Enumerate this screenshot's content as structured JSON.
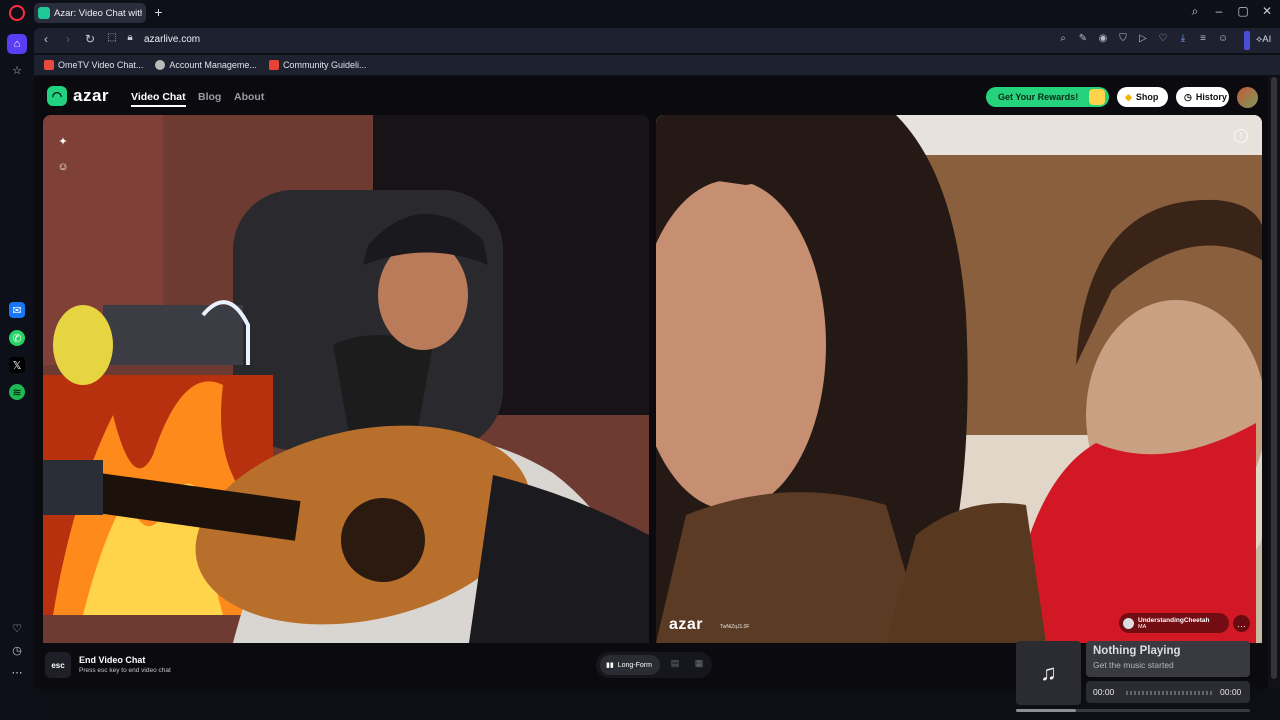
{
  "browser": {
    "tab_title": "Azar: Video Chat with Ne",
    "url": "azarlive.com",
    "ai_label": "AI",
    "bookmarks": [
      {
        "label": "OmeTV Video Chat...",
        "color": "#e74c3c"
      },
      {
        "label": "Account Manageme...",
        "color": "#bbbbbb"
      },
      {
        "label": "Community Guideli...",
        "color": "#ea4335"
      }
    ]
  },
  "header": {
    "logo_text": "azar",
    "nav": [
      "Video Chat",
      "Blog",
      "About"
    ],
    "rewards_label": "Get Your Rewards!",
    "shop_label": "Shop",
    "history_label": "History"
  },
  "remote": {
    "watermark": "azar",
    "watermark_sub": "TwNiZqJ1.0F",
    "username": "UnderstandingCheetah",
    "country": "MA"
  },
  "bottom": {
    "esc_key": "esc",
    "end_title": "End Video Chat",
    "end_sub": "Press esc key to end video chat",
    "layout_active": "Long-Form"
  },
  "music": {
    "title": "Nothing Playing",
    "subtitle": "Get the music started",
    "time_current": "00:00",
    "time_total": "00:00"
  },
  "colors": {
    "accent": "#24d37c",
    "browser_bg": "#0e1019",
    "toolbar": "#1e2130"
  }
}
